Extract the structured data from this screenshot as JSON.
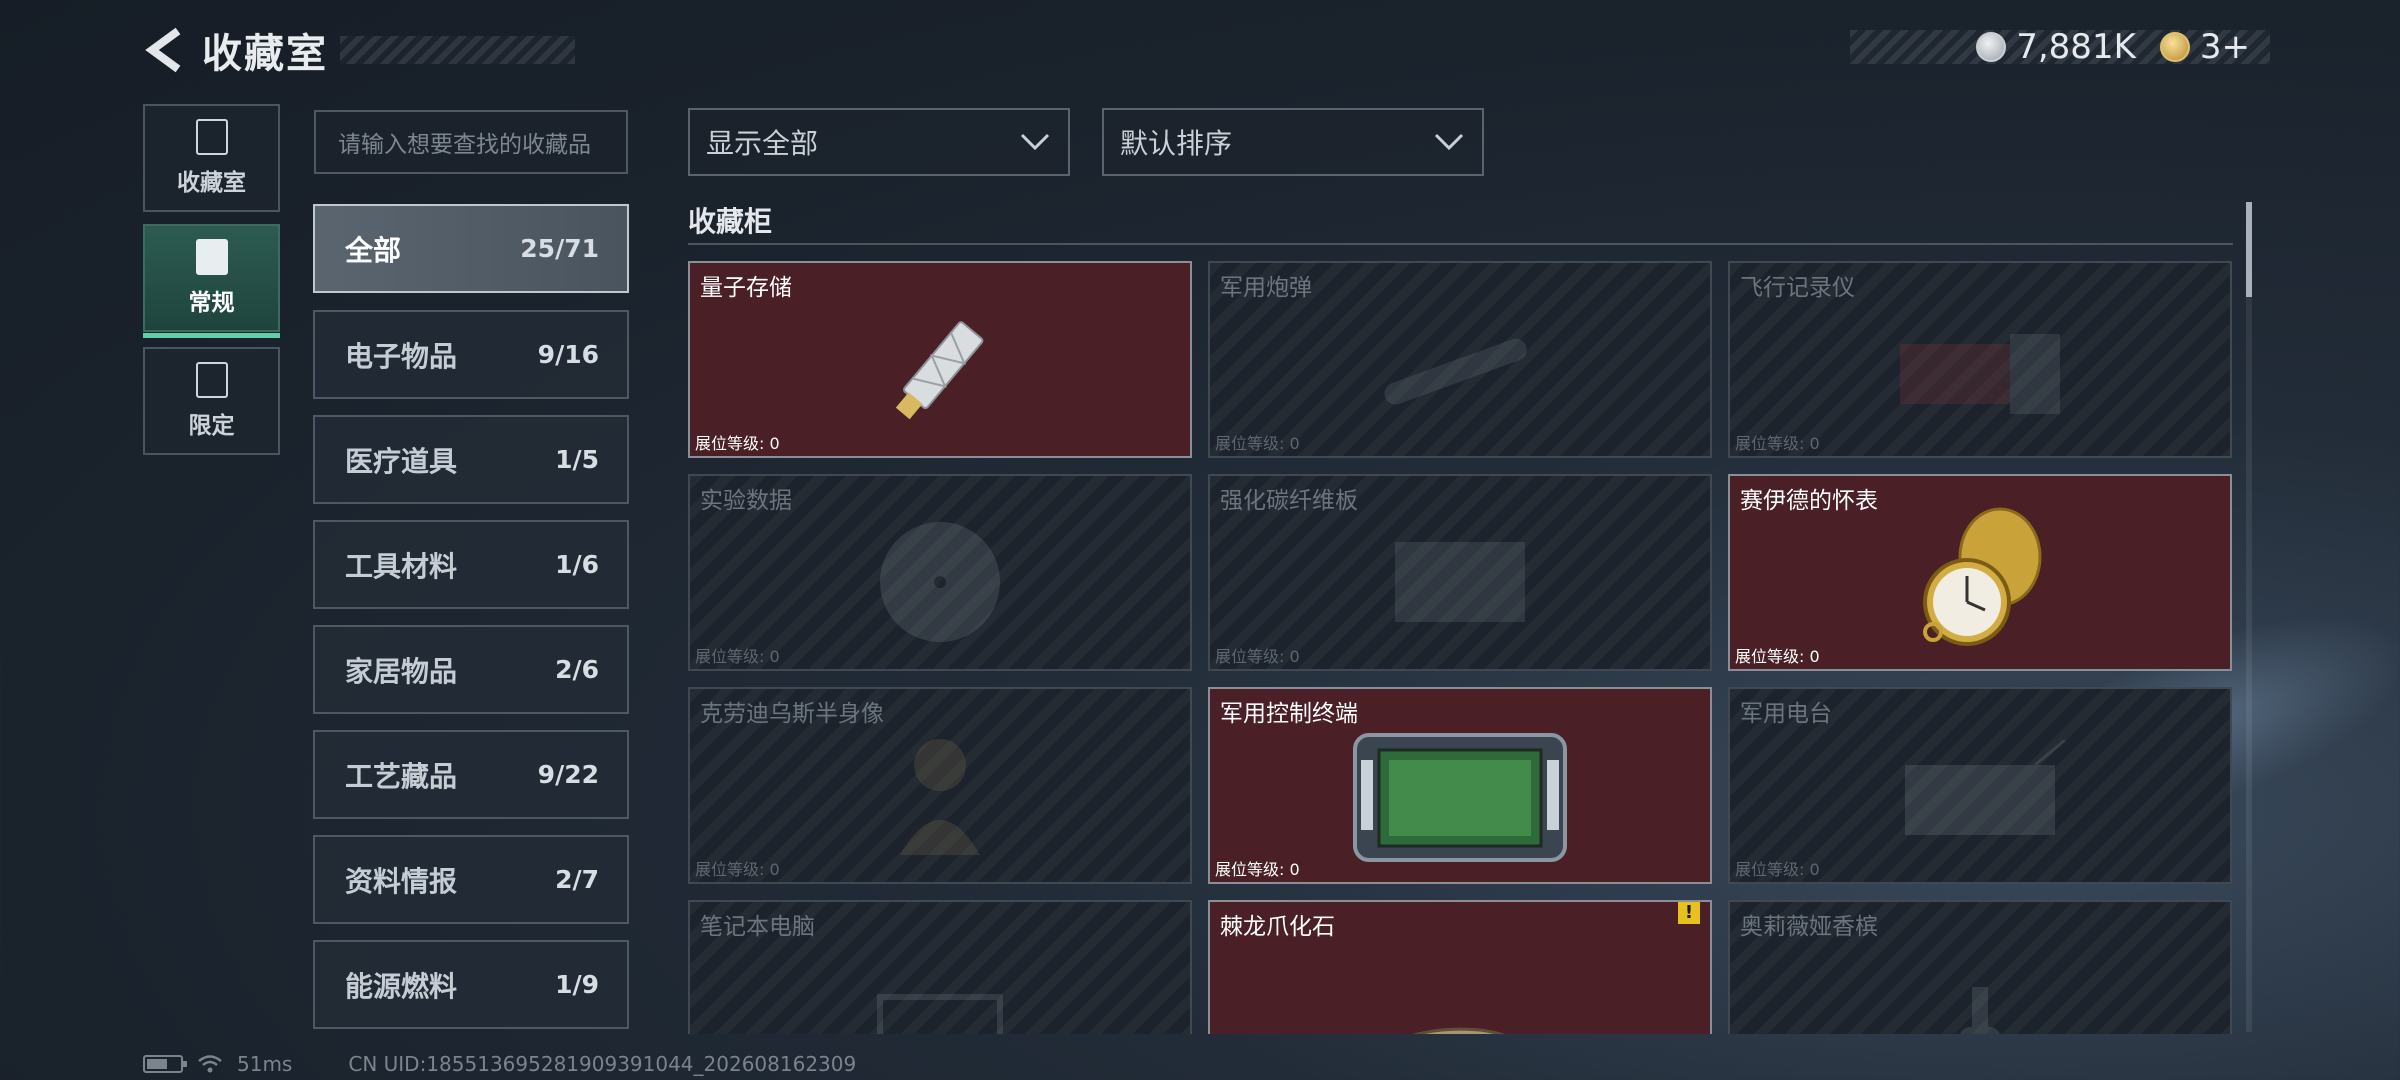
{
  "header": {
    "title": "收藏室"
  },
  "currency": [
    {
      "icon": "silver-coin-icon",
      "value": "7,881K"
    },
    {
      "icon": "gold-coin-icon",
      "value": "3+"
    }
  ],
  "side_tabs": [
    {
      "label": "收藏室",
      "icon": "collection-room-icon",
      "active": false
    },
    {
      "label": "常规",
      "icon": "regular-icon",
      "active": true
    },
    {
      "label": "限定",
      "icon": "limited-icon",
      "active": false
    }
  ],
  "search": {
    "placeholder": "请输入想要查找的收藏品"
  },
  "categories": [
    {
      "name": "全部",
      "count": "25/71",
      "active": true
    },
    {
      "name": "电子物品",
      "count": "9/16"
    },
    {
      "name": "医疗道具",
      "count": "1/5"
    },
    {
      "name": "工具材料",
      "count": "1/6"
    },
    {
      "name": "家居物品",
      "count": "2/6"
    },
    {
      "name": "工艺藏品",
      "count": "9/22"
    },
    {
      "name": "资料情报",
      "count": "2/7"
    },
    {
      "name": "能源燃料",
      "count": "1/9"
    }
  ],
  "filters": {
    "show": "显示全部",
    "sort": "默认排序"
  },
  "cabinet": {
    "title": "收藏柜",
    "level_label": "展位等级: 0",
    "items": [
      {
        "name": "量子存储",
        "owned": true,
        "art": "usb-drive"
      },
      {
        "name": "军用炮弹",
        "owned": false,
        "art": "shell"
      },
      {
        "name": "飞行记录仪",
        "owned": false,
        "art": "recorder"
      },
      {
        "name": "实验数据",
        "owned": false,
        "art": "disc"
      },
      {
        "name": "强化碳纤维板",
        "owned": false,
        "art": "plate"
      },
      {
        "name": "赛伊德的怀表",
        "owned": true,
        "art": "pocket-watch"
      },
      {
        "name": "克劳迪乌斯半身像",
        "owned": false,
        "art": "bust"
      },
      {
        "name": "军用控制终端",
        "owned": true,
        "art": "terminal"
      },
      {
        "name": "军用电台",
        "owned": false,
        "art": "radio"
      },
      {
        "name": "笔记本电脑",
        "owned": false,
        "art": "laptop"
      },
      {
        "name": "棘龙爪化石",
        "owned": true,
        "art": "claw",
        "warning": true
      },
      {
        "name": "奥莉薇娅香槟",
        "owned": false,
        "art": "bottle"
      }
    ]
  },
  "footer": {
    "ping": "51ms",
    "uid": "CN UID:1855136952819093910​44_202608162309"
  }
}
